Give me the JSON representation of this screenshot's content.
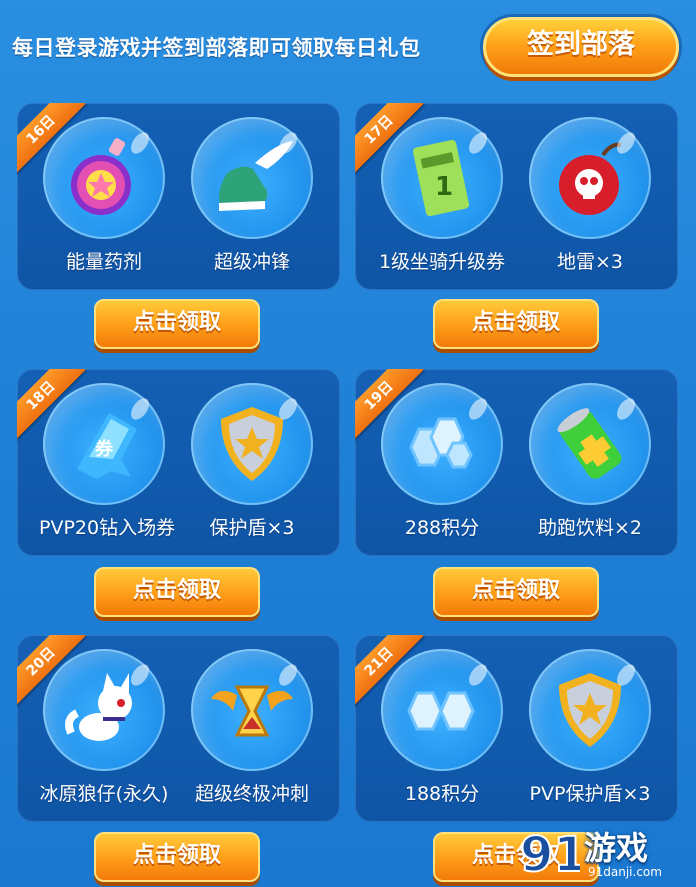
{
  "header": {
    "text": "每日登录游戏并签到部落即可领取每日礼包",
    "checkin_label": "签到部落"
  },
  "cards": [
    {
      "day": "16日",
      "items": [
        {
          "label": "能量药剂",
          "icon": "potion-icon"
        },
        {
          "label": "超级冲锋",
          "icon": "winged-shoe-icon"
        }
      ],
      "button": "点击领取"
    },
    {
      "day": "17日",
      "items": [
        {
          "label": "1级坐骑升级券",
          "icon": "ticket-icon"
        },
        {
          "label": "地雷×3",
          "icon": "bomb-icon"
        }
      ],
      "button": "点击领取"
    },
    {
      "day": "18日",
      "items": [
        {
          "label": "PVP20钻入场券",
          "icon": "voucher-icon"
        },
        {
          "label": "保护盾×3",
          "icon": "shield-icon"
        }
      ],
      "button": "点击领取"
    },
    {
      "day": "19日",
      "items": [
        {
          "label": "288积分",
          "icon": "points-icon"
        },
        {
          "label": "助跑饮料×2",
          "icon": "drink-can-icon"
        }
      ],
      "button": "点击领取"
    },
    {
      "day": "20日",
      "items": [
        {
          "label": "冰原狼仔(永久)",
          "icon": "wolf-pet-icon"
        },
        {
          "label": "超级终极冲刺",
          "icon": "winged-hourglass-icon"
        }
      ],
      "button": "点击领取"
    },
    {
      "day": "21日",
      "items": [
        {
          "label": "188积分",
          "icon": "points-icon"
        },
        {
          "label": "PVP保护盾×3",
          "icon": "shield-icon"
        }
      ],
      "button": "点击领取"
    }
  ],
  "watermark": {
    "title": "游戏",
    "logo_text": "91",
    "url": "91danji.com"
  },
  "colors": {
    "background": "#1f80d6",
    "card": "#1460b4",
    "button": "#ffa11a",
    "ribbon": "#f07010"
  }
}
